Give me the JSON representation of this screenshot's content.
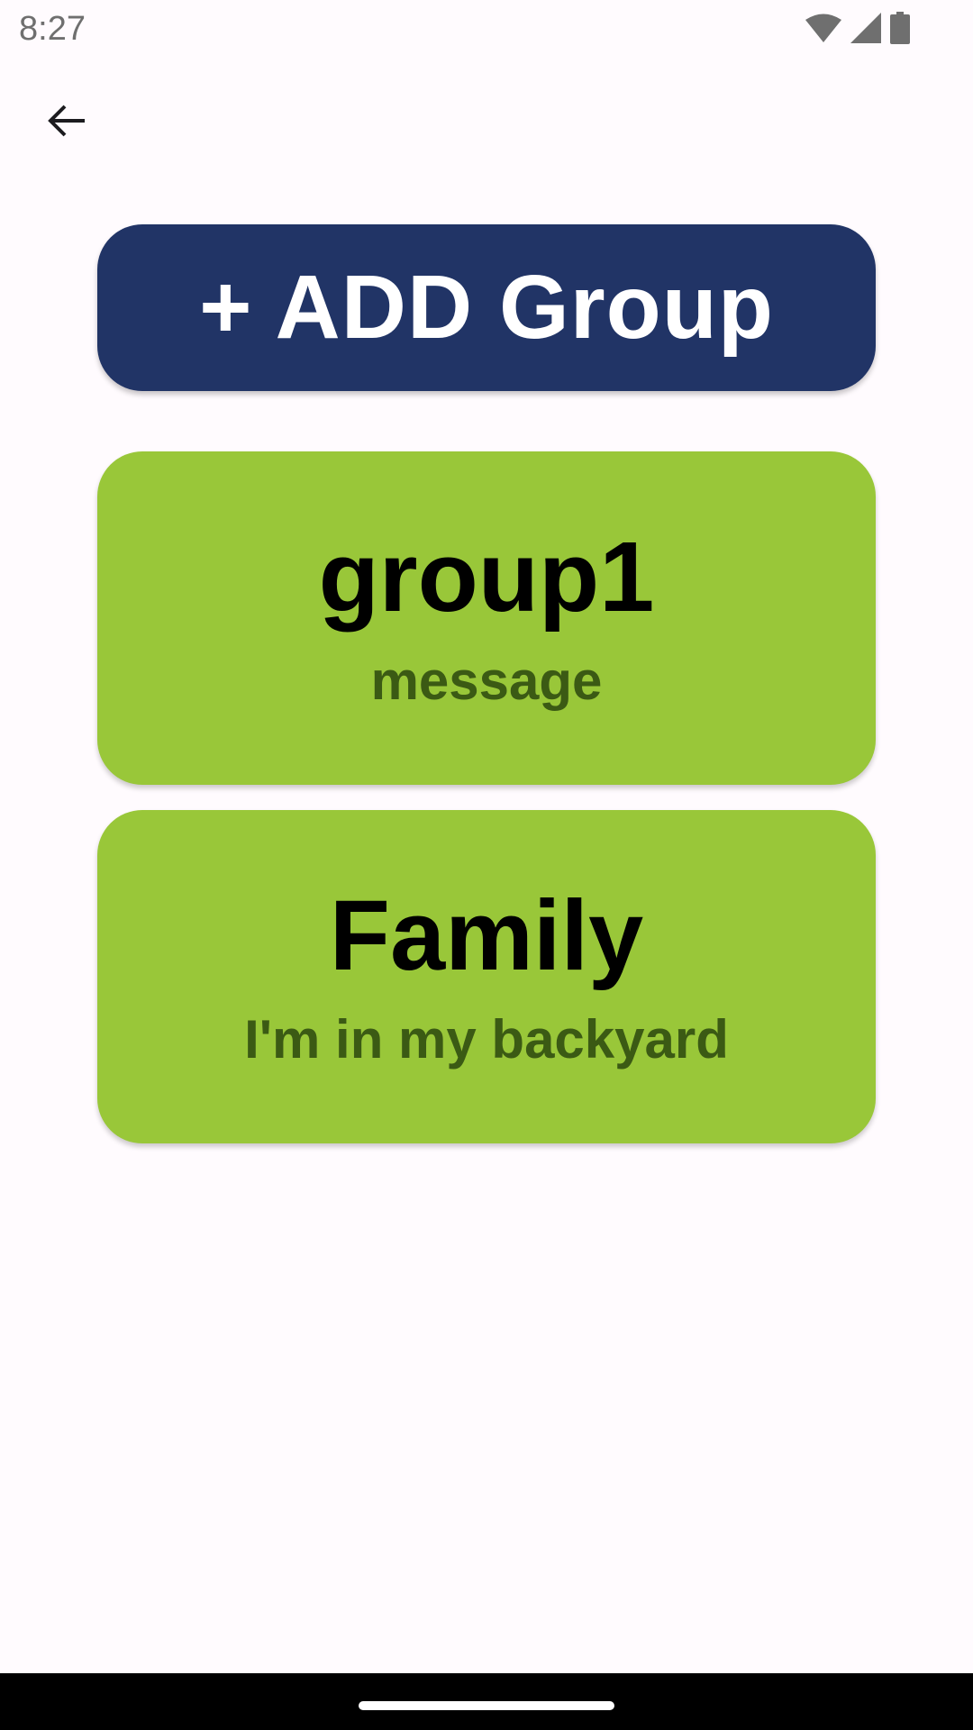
{
  "status_bar": {
    "time": "8:27",
    "icons": [
      "wifi-icon",
      "cellular-signal-icon",
      "battery-icon"
    ]
  },
  "toolbar": {
    "back_icon": "arrow-back-icon"
  },
  "add_group_button": {
    "label": "+ ADD Group",
    "background": "#213466",
    "text_color": "#ffffff"
  },
  "groups": [
    {
      "name": "group1",
      "message": "message"
    },
    {
      "name": "Family",
      "message": "I'm in my backyard"
    }
  ],
  "colors": {
    "card_background": "#99c739",
    "card_title": "#000000",
    "card_message": "#3b5a14",
    "page_background": "#fffbfe"
  }
}
